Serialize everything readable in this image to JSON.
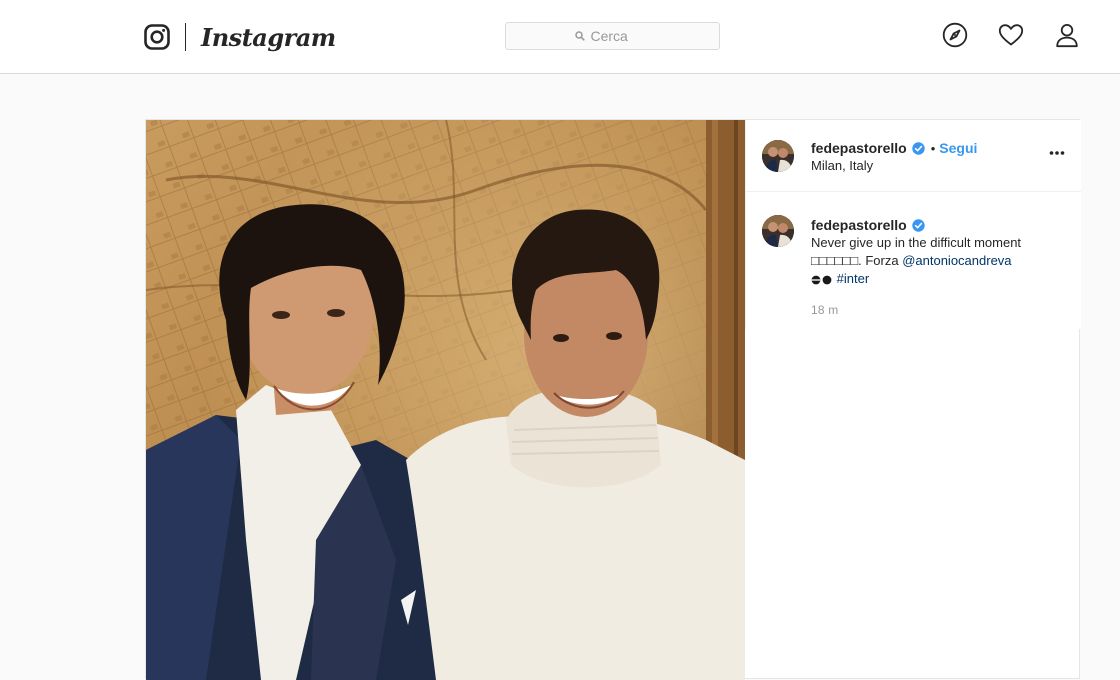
{
  "nav": {
    "logo_text": "Instagram",
    "search_placeholder": "Cerca",
    "icons": [
      "compass-icon",
      "heart-icon",
      "profile-icon"
    ]
  },
  "post": {
    "username": "fedepastorello",
    "verified": true,
    "separator": "•",
    "follow_label": "Segui",
    "location": "Milan, Italy",
    "caption": {
      "line1": "Never give up in the difficult moment",
      "line2_boxes": "□□□□□□",
      "line2_text": ". Forza ",
      "mention": "@antoniocandreva",
      "hashtag": "#inter"
    },
    "time": "18 m"
  },
  "colors": {
    "link": "#3897f0",
    "mention": "#003569",
    "border": "#dbdbdb",
    "background": "#fafafa"
  }
}
